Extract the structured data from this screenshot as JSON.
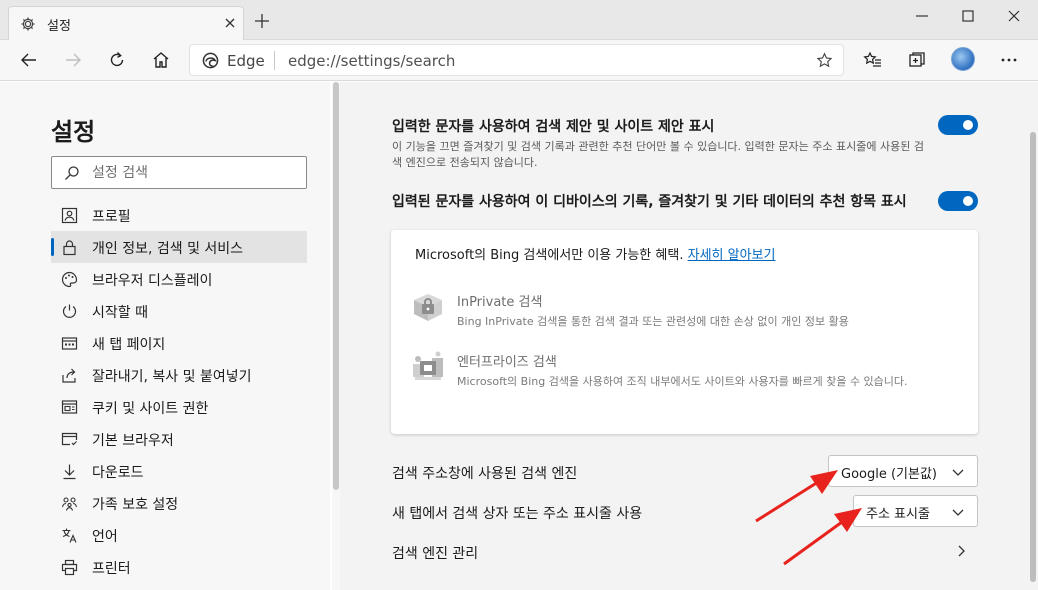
{
  "tab": {
    "title": "설정",
    "icon": "gear-icon"
  },
  "address": {
    "site": "Edge",
    "url": "edge://settings/search"
  },
  "sidebar": {
    "title": "설정",
    "search_placeholder": "설정 검색",
    "items": [
      {
        "label": "프로필",
        "icon": "profile-icon"
      },
      {
        "label": "개인 정보, 검색 및 서비스",
        "icon": "lock-icon",
        "active": true
      },
      {
        "label": "브라우저 디스플레이",
        "icon": "palette-icon"
      },
      {
        "label": "시작할 때",
        "icon": "power-icon"
      },
      {
        "label": "새 탭 페이지",
        "icon": "newtab-icon"
      },
      {
        "label": "잘라내기, 복사 및 붙여넣기",
        "icon": "share-icon"
      },
      {
        "label": "쿠키 및 사이트 권한",
        "icon": "site-permissions-icon"
      },
      {
        "label": "기본 브라우저",
        "icon": "browser-icon"
      },
      {
        "label": "다운로드",
        "icon": "download-icon"
      },
      {
        "label": "가족 보호 설정",
        "icon": "family-icon"
      },
      {
        "label": "언어",
        "icon": "language-icon"
      },
      {
        "label": "프린터",
        "icon": "printer-icon"
      }
    ]
  },
  "main": {
    "suggest": {
      "title": "입력한 문자를 사용하여 검색 제안 및 사이트 제안 표시",
      "desc": "이 기능을 끄면 즐겨찾기 및 검색 기록과 관련한 추천 단어만 볼 수 있습니다. 입력한 문자는 주소 표시줄에 사용된 검색 엔진으로 전송되지 않습니다.",
      "enabled": true
    },
    "history": {
      "title": "입력된 문자를 사용하여 이 디바이스의 기록, 즐겨찾기 및 기타 데이터의 추천 항목 표시",
      "enabled": true
    },
    "bing_card": {
      "head": "Microsoft의 Bing 검색에서만 이용 가능한 혜택.",
      "link": "자세히 알아보기",
      "features": [
        {
          "title": "InPrivate 검색",
          "desc": "Bing InPrivate 검색을 통한 검색 결과 또는 관련성에 대한 손상 없이 개인 정보 활용"
        },
        {
          "title": "엔터프라이즈 검색",
          "desc": "Microsoft의 Bing 검색을 사용하여 조직 내부에서도 사이트와 사용자를 빠르게 찾을 수 있습니다."
        }
      ]
    },
    "engine": {
      "label": "검색 주소창에 사용된 검색 엔진",
      "value": "Google (기본값)"
    },
    "newtab": {
      "label": "새 탭에서 검색 상자 또는 주소 표시줄 사용",
      "value": "주소 표시줄"
    },
    "manage": {
      "label": "검색 엔진 관리"
    }
  },
  "colors": {
    "accent": "#0067c0",
    "annotation": "#e8231d"
  }
}
